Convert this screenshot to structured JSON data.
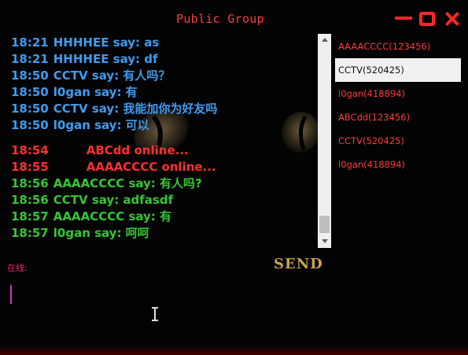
{
  "window": {
    "title": "Public Group"
  },
  "chat": {
    "messages": [
      {
        "time": "18:21",
        "text": "HHHHEE say: as",
        "kind": "chat",
        "color": "#3f9cf0"
      },
      {
        "time": "18:21",
        "text": "HHHHEE say: df",
        "kind": "chat",
        "color": "#3f9cf0"
      },
      {
        "time": "18:50",
        "text": "CCTV say: 有人吗？",
        "kind": "chat",
        "color": "#3f9cf0"
      },
      {
        "time": "18:50",
        "text": "l0gan say: 有",
        "kind": "chat",
        "color": "#3f9cf0"
      },
      {
        "time": "18:50",
        "text": "CCTV say: 我能加你为好友吗",
        "kind": "chat",
        "color": "#3f9cf0"
      },
      {
        "time": "18:50",
        "text": "l0gan say: 可以",
        "kind": "chat",
        "color": "#3f9cf0"
      },
      {
        "time": "18:54",
        "text": "ABCdd  online...",
        "kind": "system",
        "color": "#ff3030"
      },
      {
        "time": "18:55",
        "text": "AAAACCCC  online...",
        "kind": "system",
        "color": "#ff3030"
      },
      {
        "time": "18:56",
        "text": "AAAACCCC say: 有人吗?",
        "kind": "chat",
        "color": "#35c634"
      },
      {
        "time": "18:56",
        "text": "CCTV say: adfasdf",
        "kind": "chat",
        "color": "#35c634"
      },
      {
        "time": "18:57",
        "text": "AAAACCCC say: 有",
        "kind": "chat",
        "color": "#35c634"
      },
      {
        "time": "18:57",
        "text": "l0gan say: 呵呵",
        "kind": "chat",
        "color": "#35c634"
      }
    ]
  },
  "users": [
    {
      "label": "AAAACCCC(123456)",
      "selected": false
    },
    {
      "label": "CCTV(520425)",
      "selected": true
    },
    {
      "label": "l0gan(418894)",
      "selected": false
    },
    {
      "label": "ABCdd(123456)",
      "selected": false
    },
    {
      "label": "CCTV(520425)",
      "selected": false
    },
    {
      "label": "l0gan(418894)",
      "selected": false
    }
  ],
  "composer": {
    "online_label": "在线:",
    "send_label": "SEND",
    "value": ""
  },
  "icons": {
    "minimize": "minimize-icon",
    "maximize": "maximize-icon",
    "close": "close-icon"
  },
  "colors": {
    "title": "#ff3b3b",
    "window_controls": "#ff2626",
    "background": "#030303",
    "chat_old": "#3f9cf0",
    "chat_new": "#35c634",
    "system": "#ff3030",
    "user_list": "#ff3a3a",
    "online_label": "#e8236a",
    "send": "#c9a24a"
  }
}
